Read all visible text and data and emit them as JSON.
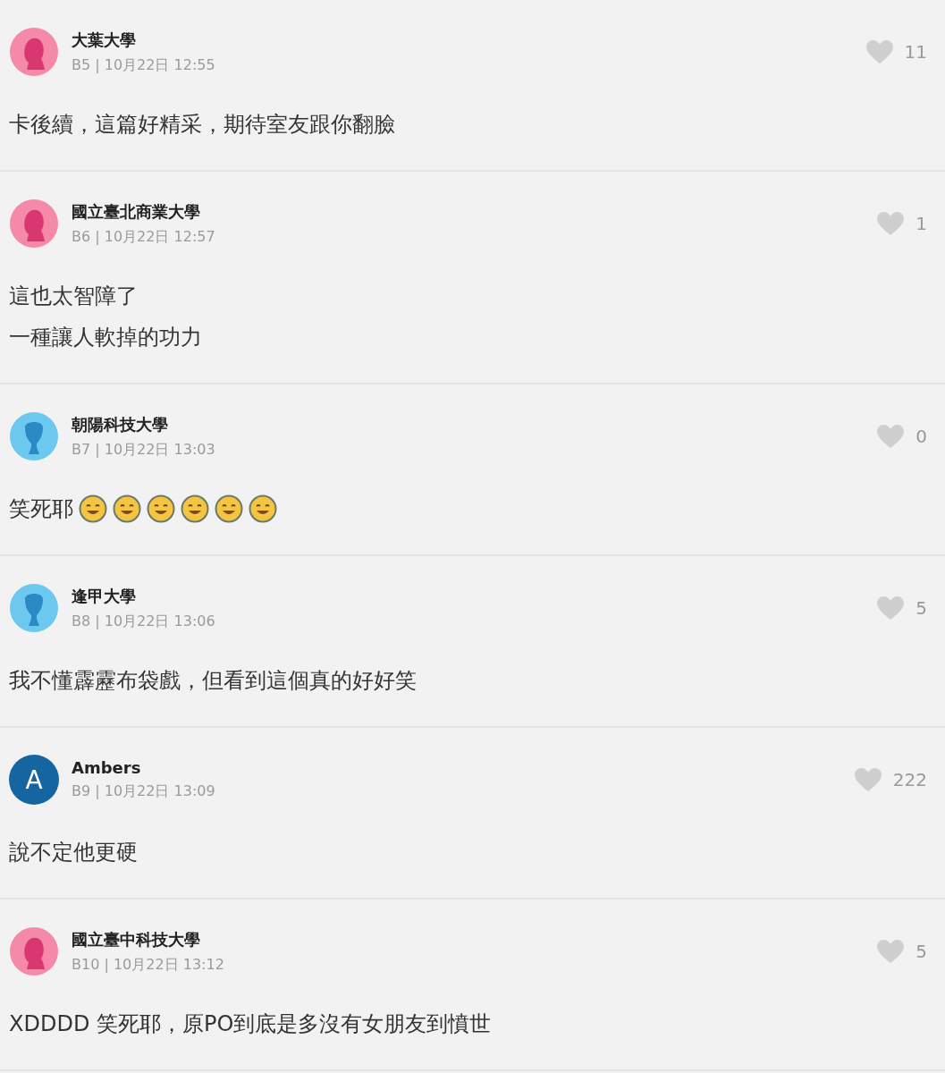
{
  "comments": [
    {
      "author": "大葉大學",
      "avatar": {
        "kind": "female"
      },
      "meta": "B5 | 10月22日 12:55",
      "likes": "11",
      "lines": [
        "卡後續，這篇好精采，期待室友跟你翻臉"
      ]
    },
    {
      "author": "國立臺北商業大學",
      "avatar": {
        "kind": "female"
      },
      "meta": "B6 | 10月22日 12:57",
      "likes": "1",
      "lines": [
        "這也太智障了",
        "一種讓人軟掉的功力"
      ]
    },
    {
      "author": "朝陽科技大學",
      "avatar": {
        "kind": "male"
      },
      "meta": "B7 | 10月22日 13:03",
      "likes": "0",
      "lines": [
        "笑死耶"
      ],
      "emojis": [
        {
          "kind": "smile"
        },
        {
          "kind": "smile"
        },
        {
          "kind": "smile"
        },
        {
          "kind": "smile"
        },
        {
          "kind": "smile"
        },
        {
          "kind": "smile"
        }
      ]
    },
    {
      "author": "逢甲大學",
      "avatar": {
        "kind": "male"
      },
      "meta": "B8 | 10月22日 13:06",
      "likes": "5",
      "lines": [
        "我不懂霹靂布袋戲，但看到這個真的好好笑"
      ]
    },
    {
      "author": "Ambers",
      "avatar": {
        "kind": "letter",
        "letter": "A"
      },
      "meta": "B9 | 10月22日 13:09",
      "likes": "222",
      "lines": [
        "說不定他更硬"
      ]
    },
    {
      "author": "國立臺中科技大學",
      "avatar": {
        "kind": "female"
      },
      "meta": "B10 | 10月22日 13:12",
      "likes": "5",
      "lines": [
        "XDDDD 笑死耶，原PO到底是多沒有女朋友到憤世"
      ]
    }
  ]
}
